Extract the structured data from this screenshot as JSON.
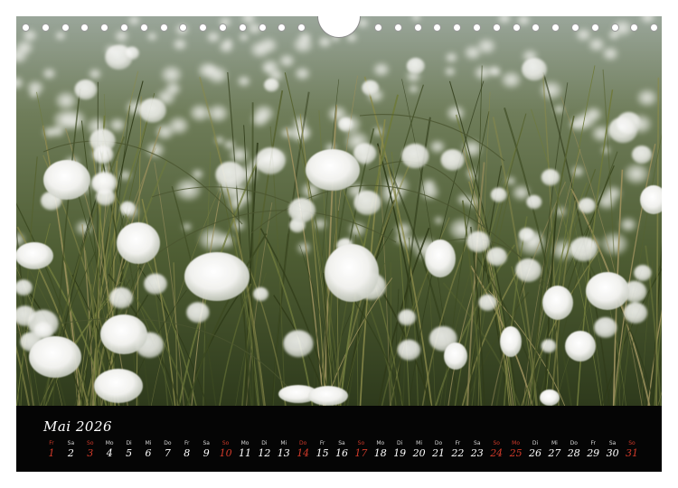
{
  "calendar": {
    "month_title": "Mai 2026",
    "days": [
      {
        "dow": "Fr",
        "num": "1",
        "red": true
      },
      {
        "dow": "Sa",
        "num": "2",
        "red": false
      },
      {
        "dow": "So",
        "num": "3",
        "red": true
      },
      {
        "dow": "Mo",
        "num": "4",
        "red": false
      },
      {
        "dow": "Di",
        "num": "5",
        "red": false
      },
      {
        "dow": "Mi",
        "num": "6",
        "red": false
      },
      {
        "dow": "Do",
        "num": "7",
        "red": false
      },
      {
        "dow": "Fr",
        "num": "8",
        "red": false
      },
      {
        "dow": "Sa",
        "num": "9",
        "red": false
      },
      {
        "dow": "So",
        "num": "10",
        "red": true
      },
      {
        "dow": "Mo",
        "num": "11",
        "red": false
      },
      {
        "dow": "Di",
        "num": "12",
        "red": false
      },
      {
        "dow": "Mi",
        "num": "13",
        "red": false
      },
      {
        "dow": "Do",
        "num": "14",
        "red": true
      },
      {
        "dow": "Fr",
        "num": "15",
        "red": false
      },
      {
        "dow": "Sa",
        "num": "16",
        "red": false
      },
      {
        "dow": "So",
        "num": "17",
        "red": true
      },
      {
        "dow": "Mo",
        "num": "18",
        "red": false
      },
      {
        "dow": "Di",
        "num": "19",
        "red": false
      },
      {
        "dow": "Mi",
        "num": "20",
        "red": false
      },
      {
        "dow": "Do",
        "num": "21",
        "red": false
      },
      {
        "dow": "Fr",
        "num": "22",
        "red": false
      },
      {
        "dow": "Sa",
        "num": "23",
        "red": false
      },
      {
        "dow": "So",
        "num": "24",
        "red": true
      },
      {
        "dow": "Mo",
        "num": "25",
        "red": true
      },
      {
        "dow": "Di",
        "num": "26",
        "red": false
      },
      {
        "dow": "Mi",
        "num": "27",
        "red": false
      },
      {
        "dow": "Do",
        "num": "28",
        "red": false
      },
      {
        "dow": "Fr",
        "num": "29",
        "red": false
      },
      {
        "dow": "Sa",
        "num": "30",
        "red": false
      },
      {
        "dow": "So",
        "num": "31",
        "red": true
      }
    ]
  },
  "colors": {
    "background": "#ffffff",
    "calendar_band": "#050505",
    "weekday_text": "#ffffff",
    "holiday_text": "#d23a2a"
  },
  "photo": {
    "subject": "cotton-grass-meadow"
  }
}
